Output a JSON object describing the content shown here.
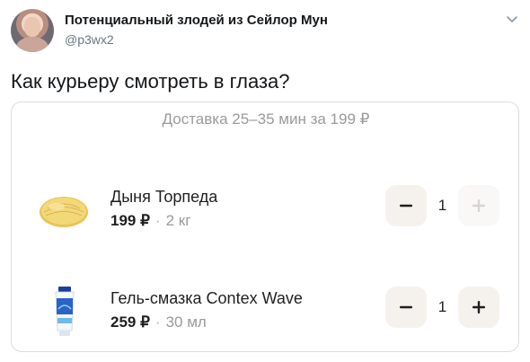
{
  "tweet": {
    "author_name": "Потенциальный злодей из Сейлор Мун",
    "handle": "@p3wx2",
    "text": "Как курьеру смотреть в глаза?"
  },
  "card": {
    "delivery_text": "Доставка 25–35 мин за 199 ₽",
    "items": [
      {
        "title": "Дыня Торпеда",
        "price": "199 ₽",
        "separator": "·",
        "unit": "2 кг",
        "quantity": "1",
        "plus_enabled": false
      },
      {
        "title": "Гель-смазка Contex Wave",
        "price": "259 ₽",
        "separator": "·",
        "unit": "30 мл",
        "quantity": "1",
        "plus_enabled": true
      }
    ]
  },
  "colors": {
    "button_bg": "#f5f2ee",
    "muted_text": "#9a9a9a",
    "handle": "#657786"
  },
  "icons": {
    "menu": "chevron-down-icon",
    "minus": "minus-icon",
    "plus": "plus-icon"
  }
}
